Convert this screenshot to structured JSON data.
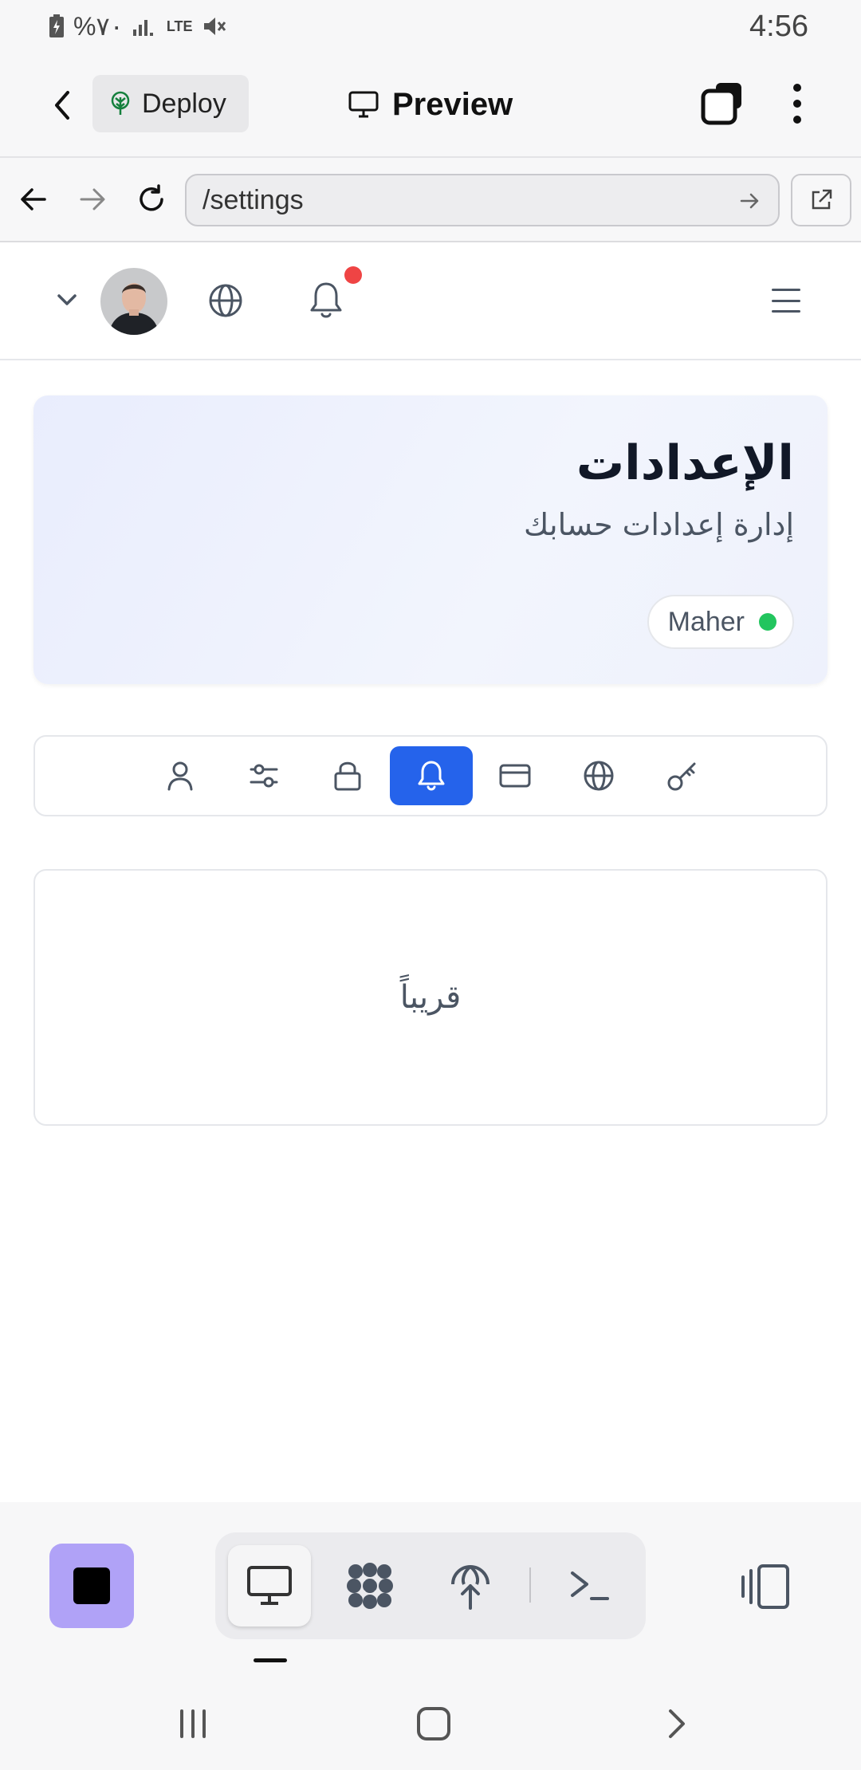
{
  "status_bar": {
    "left_text": "%٧٠",
    "network": "LTE",
    "time": "4:56"
  },
  "app_header": {
    "deploy_label": "Deploy",
    "preview_label": "Preview"
  },
  "url_bar": {
    "url": "/settings"
  },
  "site_nav": {
    "avatar_alt": "avatar",
    "has_notification": true
  },
  "hero": {
    "title": "الإعدادات",
    "subtitle": "إدارة إعدادات حسابك",
    "user_name": "Maher",
    "status_color": "#22c55e"
  },
  "settings_tabs": {
    "items": [
      {
        "icon": "user-icon",
        "active": false
      },
      {
        "icon": "sliders-icon",
        "active": false
      },
      {
        "icon": "lock-icon",
        "active": false
      },
      {
        "icon": "bell-icon",
        "active": true
      },
      {
        "icon": "credit-card-icon",
        "active": false
      },
      {
        "icon": "globe-icon",
        "active": false
      },
      {
        "icon": "key-icon",
        "active": false
      }
    ],
    "accent": "#2563eb"
  },
  "content": {
    "placeholder": "قريباً"
  },
  "bottom_toolbar": {
    "stop_color": "#b0a2f7",
    "modes": [
      "monitor-icon",
      "grid-icon",
      "deploy-icon",
      "terminal-icon"
    ],
    "active_mode": "monitor-icon"
  }
}
